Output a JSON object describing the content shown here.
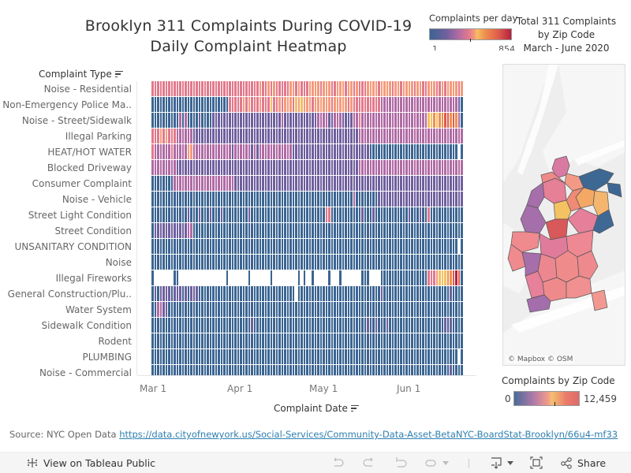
{
  "title": {
    "line1": "Brooklyn 311 Complaints During COVID-19",
    "line2": "Daily Complaint Heatmap"
  },
  "legend_daily": {
    "title": "Complaints per day",
    "min_label": "1",
    "max_label": "854",
    "colors": [
      "#3b6592",
      "#6f5f9e",
      "#b06aa4",
      "#e3798c",
      "#f69a7a",
      "#f4c060",
      "#ef8f4e",
      "#de5a4c",
      "#b5213f"
    ]
  },
  "map_title": {
    "line1": "Total 311 Complaints",
    "line2": "by Zip Code",
    "line3": "March - June 2020"
  },
  "map": {
    "attribution": "© Mapbox  © OSM"
  },
  "legend_zip": {
    "title": "Complaints by Zip Code",
    "min_label": "0",
    "max_label": "12,459"
  },
  "source": {
    "prefix": "Source: NYC Open Data ",
    "link_text": "https://data.cityofnewyork.us/Social-Services/Community-Data-Asset-BetaNYC-BoardStat-Brooklyn/66u4-mf33"
  },
  "toolbar": {
    "view_label": "View on Tableau Public",
    "share_label": "Share"
  },
  "chart_data": {
    "type": "heatmap",
    "title": "Daily Complaint Heatmap",
    "xlabel": "Complaint Date",
    "ylabel": "Complaint Type",
    "x_ticks": [
      "Mar 1",
      "Apr 1",
      "May 1",
      "Jun 1"
    ],
    "x_range": [
      "2020-03-01",
      "2020-06-21"
    ],
    "days": 113,
    "color_range": [
      1,
      854
    ],
    "rows": [
      {
        "name": "Noise - Residential",
        "level_profile": "high, rising Apr-Jun with peaks late May/June",
        "levels": "3333333333333333333333333333333333333334334343333344343334444344433444344343334444344443443444434433444334344443434"
      },
      {
        "name": "Non-Emergency Police Ma..",
        "level_profile": "low until ~Mar 30, then elevated through May, tapering in June",
        "levels": "0000000000000000000000000000333334343334333533434443545444344444434444434333333333322222222222222222222222222221"
      },
      {
        "name": "Noise - Street/Sidewalk",
        "level_profile": "low in Mar-Apr, rising in May, peaking mid-June",
        "levels": "0000000000202000010000111111111111111111111111121111111111112222112221111223222222222222222222222222556566776762"
      },
      {
        "name": "Illegal Parking",
        "level_profile": "elevated early March, dropping then moderate",
        "levels": "3334343332222221111111111111111111111111111111111111111111111111111111111112222222222222222222222222222222222222221"
      },
      {
        "name": "HEAT/HOT WATER",
        "level_profile": "moderate in Mar-Apr, fading by May, gap near end",
        "levels": "322222232222244222222222222221222222121222222222222111111111111111111111111111100000000000000000000000000000000x0"
      },
      {
        "name": "Blocked Driveway",
        "level_profile": "moderate throughout",
        "levels": "2222222221111111111111111111111111111111111111111111111111111111111111111112222222222222222222222222222222222222221"
      },
      {
        "name": "Consumer Complaint",
        "level_profile": "low, with a bump late March to mid April",
        "levels": "0000000022222222222222222222221111111111111111111111111111111111111111111111111111111111111111111111111111111111110"
      },
      {
        "name": "Noise - Vehicle",
        "level_profile": "low, rising slightly in May-June",
        "levels": "0000000000000000000000000000000000000000000000000000000000000000000000000200000000111111111111111111111111111111110"
      },
      {
        "name": "Street Light Condition",
        "level_profile": "low with occasional spikes",
        "levels": "0000000000000100010001000100000000010000000000000000000000000003300000000000100010000000000001000100300000000000000"
      },
      {
        "name": "Street Condition",
        "level_profile": "low, small bump mid March",
        "levels": "0111111111111220000000000000000000000000000000000000000000000000000000000000000000000000000000000000000000000000000"
      },
      {
        "name": "UNSANITARY CONDITION",
        "level_profile": "low, gap near end",
        "levels": "000000000000000000000000000000000000000000000000000000000000000000000000000000000000000000000000000000000000000x0"
      },
      {
        "name": "Noise",
        "level_profile": "low throughout",
        "levels": "0000000000000000000000000000000000000000000000000000000000000000000000000000000000000000000000000000000000000000"
      },
      {
        "name": "Illegal Fireworks",
        "level_profile": "sparse until late May, then surging sharply in June",
        "levels": "0xxxxxxx00xxxxxxxxxxxxxxxxx0xxxxxxx0xxxxxxx0xxxxxxxxx0x0xx0xxxxx0xxx0xxxxxxx000xxxx00000000000000000333455566787"
      },
      {
        "name": "General Construction/Plu..",
        "level_profile": "low with slight early bumps; one gap in mid-April",
        "levels": "0101111011101011100000000000000000000000000000000000x000000000000000000000000000000100000000000000000000000010000"
      },
      {
        "name": "Water System",
        "level_profile": "low, slight bump early March",
        "levels": "0022110000000000000000000000000000000000000000000000000000000000000000000000000000000000000000000000000000000000"
      },
      {
        "name": "Sidewalk Condition",
        "level_profile": "low, sparse bumps",
        "levels": "0000000000000000000000000000000000001000000000000000000000000000000000000000001001000100000000000000000000101000"
      },
      {
        "name": "Rodent",
        "level_profile": "low throughout",
        "levels": "0000000000000000000000000000000000000000000000000000000000000000000000000000000000000000000000000000000000000000000"
      },
      {
        "name": "PLUMBING",
        "level_profile": "low, gap near end",
        "levels": "000000000000000000000000000000000000000000000000000000000000000000000000000000000000000000000000000000000000000x0"
      },
      {
        "name": "Noise - Commercial",
        "level_profile": "low, slight rise late June",
        "levels": "0000000000000000000000000000000000000000000000000000000000000000000000000000000000000000000000000000000000001000"
      }
    ]
  }
}
